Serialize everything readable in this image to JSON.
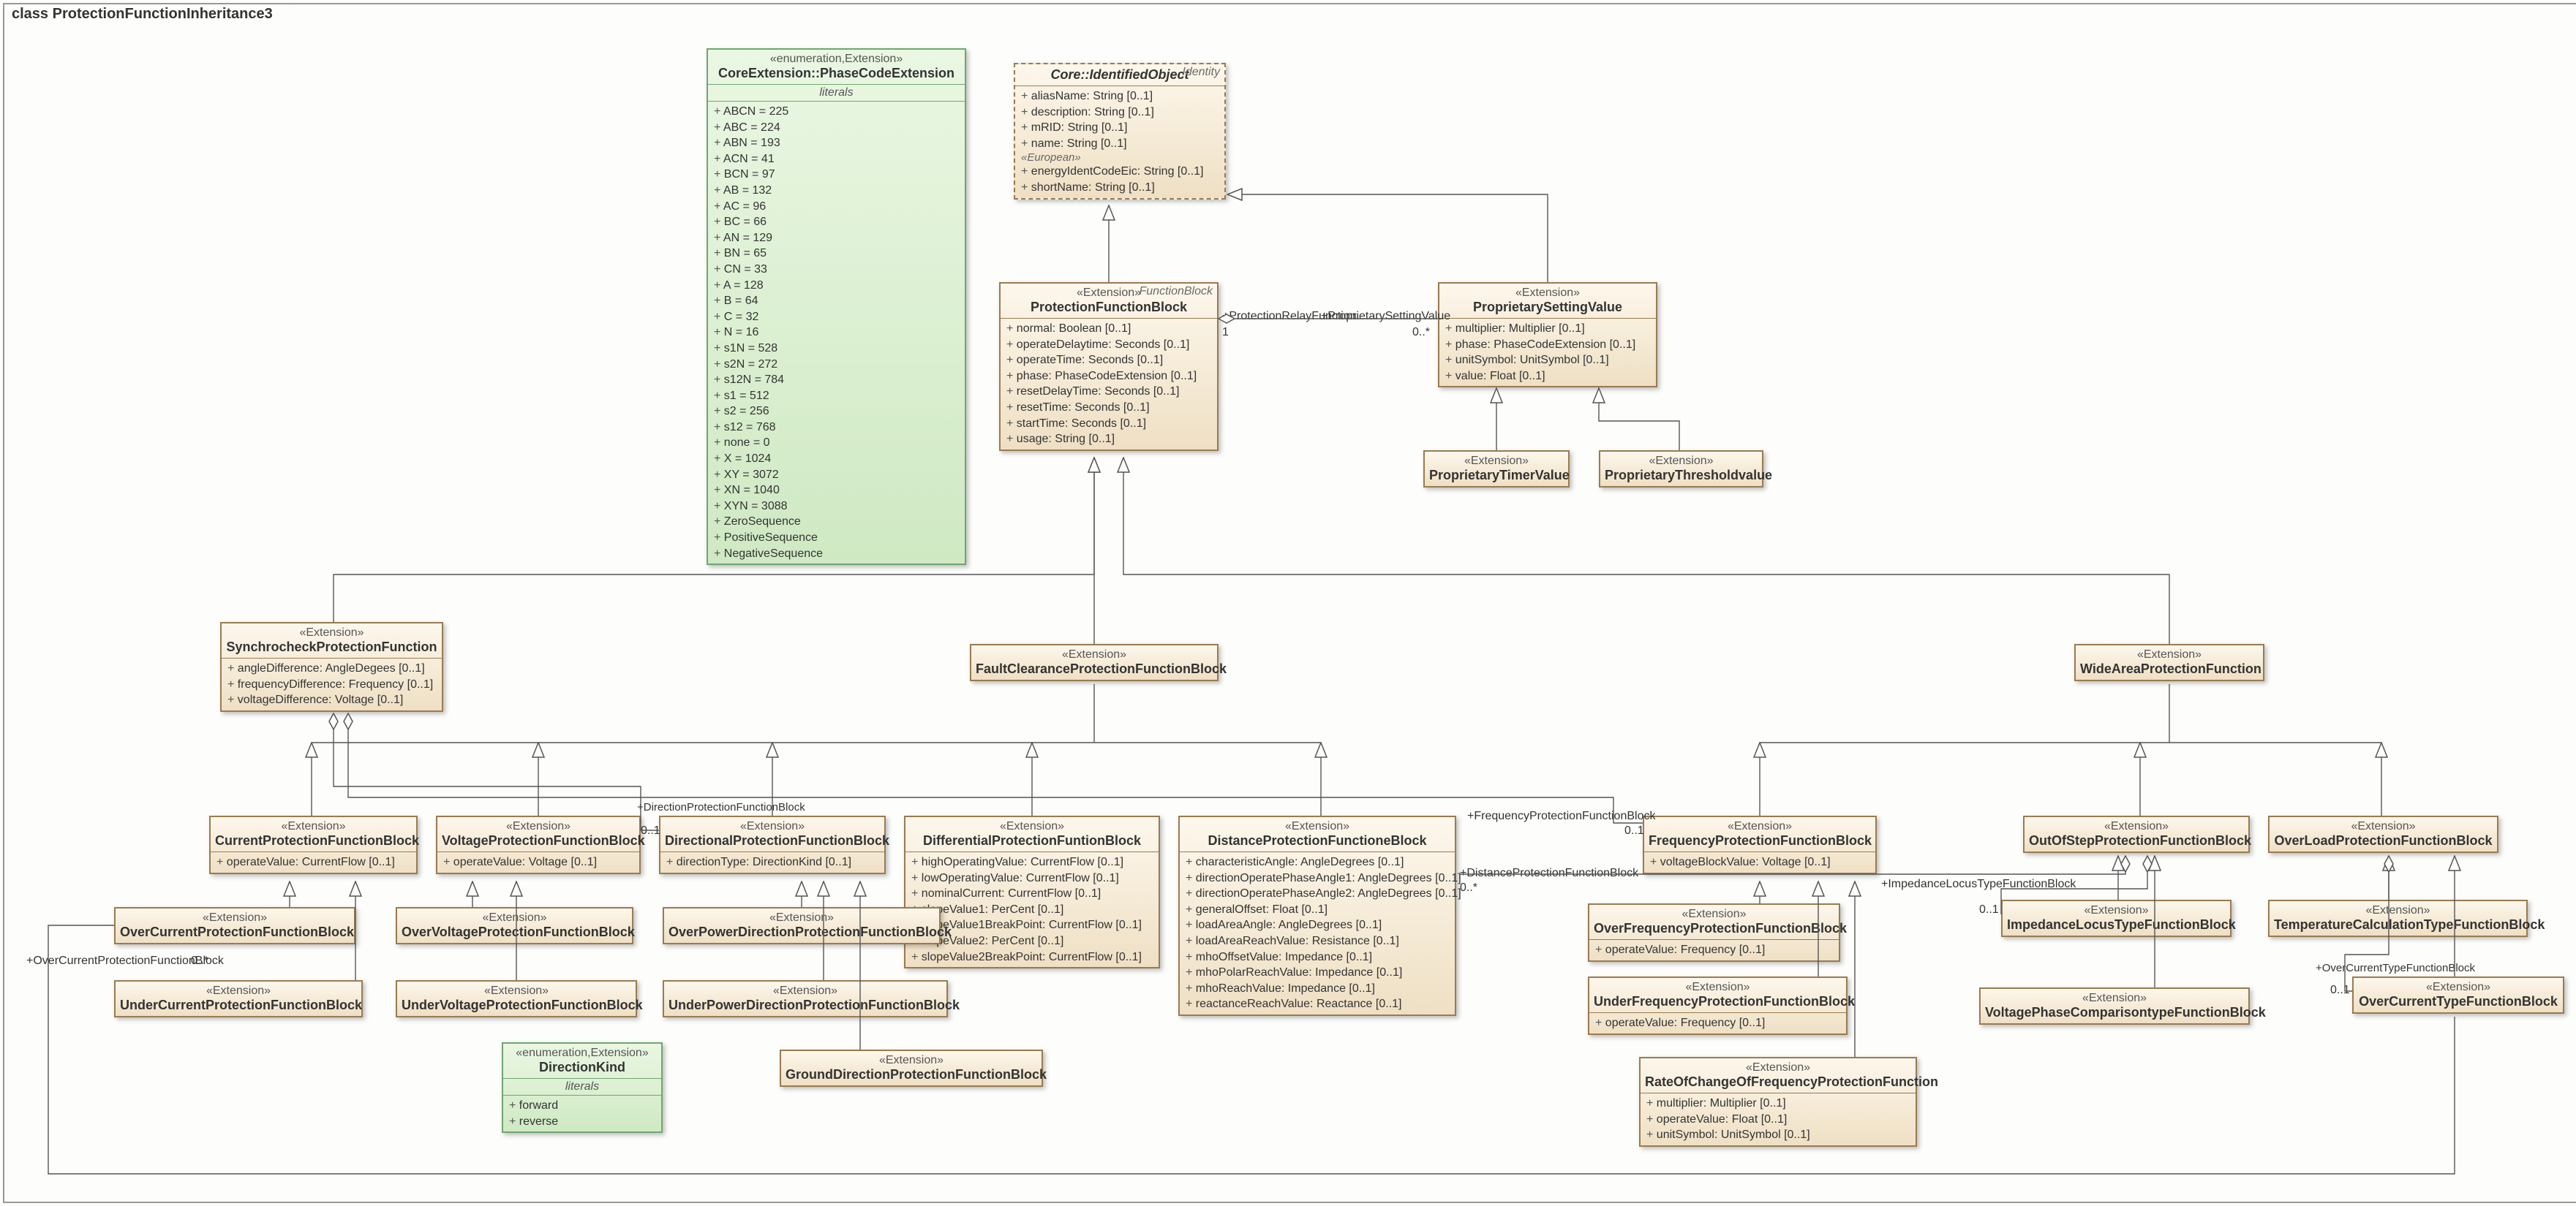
{
  "frame": {
    "keyword": "class",
    "name": "ProtectionFunctionInheritance3"
  },
  "enum_phasecode": {
    "stereo": "«enumeration,Extension»",
    "name": "CoreExtension::PhaseCodeExtension",
    "section": "literals",
    "values": [
      "ABCN = 225",
      "ABC = 224",
      "ABN = 193",
      "ACN = 41",
      "BCN = 97",
      "AB = 132",
      "AC = 96",
      "BC = 66",
      "AN = 129",
      "BN = 65",
      "CN = 33",
      "A = 128",
      "B = 64",
      "C = 32",
      "N = 16",
      "s1N = 528",
      "s2N = 272",
      "s12N = 784",
      "s1 = 512",
      "s2 = 256",
      "s12 = 768",
      "none = 0",
      "X = 1024",
      "XY = 3072",
      "XN = 1040",
      "XYN = 3088",
      "ZeroSequence",
      "PositiveSequence",
      "NegativeSequence"
    ]
  },
  "enum_directionkind": {
    "stereo": "«enumeration,Extension»",
    "name": "DirectionKind",
    "section": "literals",
    "values": [
      "forward",
      "reverse"
    ]
  },
  "identified": {
    "corner": "Identity",
    "name": "Core::IdentifiedObject",
    "attrs_top": [
      "aliasName: String [0..1]",
      "description: String [0..1]",
      "mRID: String [0..1]",
      "name: String [0..1]"
    ],
    "european": "«European»",
    "attrs_bot": [
      "energyIdentCodeEic: String [0..1]",
      "shortName: String [0..1]"
    ]
  },
  "pfb": {
    "corner": "FunctionBlock",
    "stereo": "«Extension»",
    "name": "ProtectionFunctionBlock",
    "attrs": [
      "normal: Boolean [0..1]",
      "operateDelaytime: Seconds [0..1]",
      "operateTime: Seconds [0..1]",
      "phase: PhaseCodeExtension [0..1]",
      "resetDelayTime: Seconds [0..1]",
      "resetTime: Seconds [0..1]",
      "startTime: Seconds [0..1]",
      "usage: String [0..1]"
    ]
  },
  "psv": {
    "stereo": "«Extension»",
    "name": "ProprietarySettingValue",
    "attrs": [
      "multiplier: Multiplier [0..1]",
      "phase: PhaseCodeExtension [0..1]",
      "unitSymbol: UnitSymbol [0..1]",
      "value: Float [0..1]"
    ]
  },
  "psv_timer": {
    "stereo": "«Extension»",
    "name": "ProprietaryTimerValue"
  },
  "psv_thresh": {
    "stereo": "«Extension»",
    "name": "ProprietaryThresholdvalue"
  },
  "sync": {
    "stereo": "«Extension»",
    "name": "SynchrocheckProtectionFunction",
    "attrs": [
      "angleDifference: AngleDegees [0..1]",
      "frequencyDifference: Frequency [0..1]",
      "voltageDifference: Voltage [0..1]"
    ]
  },
  "fcpfb": {
    "stereo": "«Extension»",
    "name": "FaultClearanceProtectionFunctionBlock"
  },
  "wapf": {
    "stereo": "«Extension»",
    "name": "WideAreaProtectionFunction"
  },
  "cur": {
    "stereo": "«Extension»",
    "name": "CurrentProtectionFunctionBlock",
    "attrs": [
      "operateValue: CurrentFlow [0..1]"
    ]
  },
  "volt": {
    "stereo": "«Extension»",
    "name": "VoltageProtectionFunctionBlock",
    "attrs": [
      "operateValue: Voltage [0..1]"
    ]
  },
  "dir": {
    "stereo": "«Extension»",
    "name": "DirectionalProtectionFunctionBlock",
    "attrs": [
      "directionType: DirectionKind [0..1]"
    ]
  },
  "diff": {
    "stereo": "«Extension»",
    "name": "DifferentialProtectionFuntionBlock",
    "attrs": [
      "highOperatingValue: CurrentFlow [0..1]",
      "lowOperatingValue: CurrentFlow [0..1]",
      "nominalCurrent: CurrentFlow [0..1]",
      "slopeValue1: PerCent [0..1]",
      "slopeValue1BreakPoint: CurrentFlow [0..1]",
      "slopeValue2: PerCent [0..1]",
      "slopeValue2BreakPoint: CurrentFlow [0..1]"
    ]
  },
  "dist": {
    "stereo": "«Extension»",
    "name": "DistanceProtectionFunctioneBlock",
    "attrs": [
      "characteristicAngle: AngleDegrees [0..1]",
      "directionOperatePhaseAngle1: AngleDegrees [0..1]",
      "directionOperatePhaseAngle2: AngleDegrees [0..1]",
      "generalOffset: Float [0..1]",
      "loadAreaAngle: AngleDegrees [0..1]",
      "loadAreaReachValue: Resistance [0..1]",
      "mhoOffsetValue: Impedance [0..1]",
      "mhoPolarReachValue: Impedance [0..1]",
      "mhoReachValue: Impedance [0..1]",
      "reactanceReachValue: Reactance [0..1]"
    ]
  },
  "freq": {
    "stereo": "«Extension»",
    "name": "FrequencyProtectionFunctionBlock",
    "attrs": [
      "voltageBlockValue: Voltage [0..1]"
    ]
  },
  "oos": {
    "stereo": "«Extension»",
    "name": "OutOfStepProtectionFunctionBlock"
  },
  "ovl": {
    "stereo": "«Extension»",
    "name": "OverLoadProtectionFunctionBlock"
  },
  "overCur": {
    "stereo": "«Extension»",
    "name": "OverCurrentProtectionFunctionBlock"
  },
  "underCur": {
    "stereo": "«Extension»",
    "name": "UnderCurrentProtectionFunctionBlock"
  },
  "overVolt": {
    "stereo": "«Extension»",
    "name": "OverVoltageProtectionFunctionBlock"
  },
  "underVolt": {
    "stereo": "«Extension»",
    "name": "UnderVoltageProtectionFunctionBlock"
  },
  "overPowDir": {
    "stereo": "«Extension»",
    "name": "OverPowerDirectionProtectionFunctionBlock"
  },
  "underPowDir": {
    "stereo": "«Extension»",
    "name": "UnderPowerDirectionProtectionFunctionBlock"
  },
  "groundDir": {
    "stereo": "«Extension»",
    "name": "GroundDirectionProtectionFunctionBlock"
  },
  "overFreq": {
    "stereo": "«Extension»",
    "name": "OverFrequencyProtectionFunctionBlock",
    "attrs": [
      "operateValue: Frequency [0..1]"
    ]
  },
  "underFreq": {
    "stereo": "«Extension»",
    "name": "UnderFrequencyProtectionFunctionBlock",
    "attrs": [
      "operateValue: Frequency [0..1]"
    ]
  },
  "rocof": {
    "stereo": "«Extension»",
    "name": "RateOfChangeOfFrequencyProtectionFunction",
    "attrs": [
      "multiplier: Multiplier [0..1]",
      "operateValue: Float [0..1]",
      "unitSymbol: UnitSymbol [0..1]"
    ]
  },
  "impLocus": {
    "stereo": "«Extension»",
    "name": "ImpedanceLocusTypeFunctionBlock"
  },
  "vpcType": {
    "stereo": "«Extension»",
    "name": "VoltagePhaseComparisontypeFunctionBlock"
  },
  "tempCalc": {
    "stereo": "«Extension»",
    "name": "TemperatureCalculationTypeFunctionBlock"
  },
  "ocType": {
    "stereo": "«Extension»",
    "name": "OverCurrentTypeFunctionBlock"
  },
  "assoc": {
    "prf": "+ProtectionRelayFunction",
    "prf_mult": "1",
    "psv": "+ProprietarySettingValue",
    "psv_mult": "0..*",
    "dirFB": "+DirectionProtectionFunctionBlock",
    "dirFB_mult": "0..1",
    "freqFB": "+FrequencyProtectionFunctionBlock",
    "freqFB_mult": "0..1",
    "distFB": "+DistanceProtectionFunctionBlock",
    "distFB_mult": "0..*",
    "impFB": "+ImpedanceLocusTypeFunctionBlock",
    "impFB_mult": "0..1",
    "ocPFB": "+OverCurrentProtectionFunctionBlock",
    "ocPFB_mult": "0..*",
    "ocTFB": "+OverCurrentTypeFunctionBlock",
    "ocTFB_mult": "0..1"
  }
}
